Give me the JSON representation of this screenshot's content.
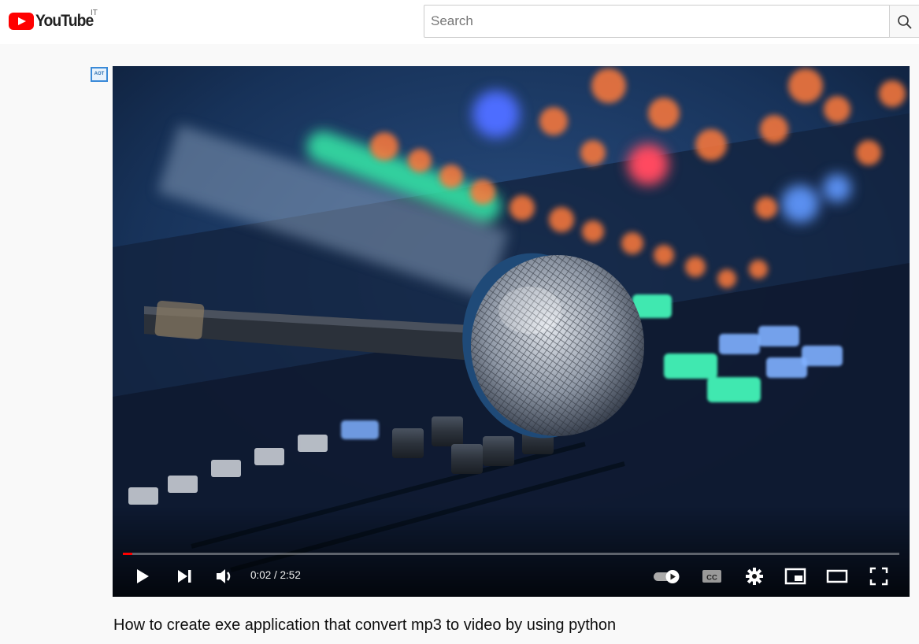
{
  "header": {
    "logo_text": "YouTube",
    "country_code": "IT",
    "search_placeholder": "Search",
    "search_icon": "search-icon"
  },
  "overlay": {
    "aot_badge": "AOT"
  },
  "player": {
    "progress_fraction": 0.012,
    "progress_color": "#ff0000",
    "current_time": "0:02",
    "separator": " / ",
    "duration": "2:52",
    "controls_left": [
      "play-icon",
      "next-icon",
      "volume-icon"
    ],
    "controls_right": [
      "autoplay-toggle-icon",
      "subtitles-icon",
      "settings-icon",
      "miniplayer-icon",
      "theater-mode-icon",
      "fullscreen-icon"
    ]
  },
  "video": {
    "title": "How to create exe application that convert mp3 to video by using python"
  }
}
